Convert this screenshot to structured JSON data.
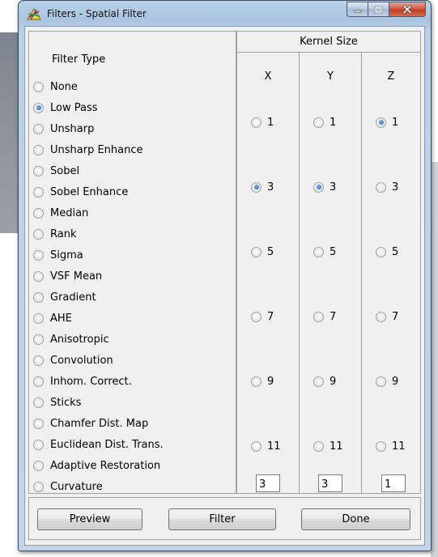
{
  "window": {
    "title": "Filters - Spatial Filter",
    "app_icon": "triangle-axes-icon",
    "controls": [
      "minimize-icon",
      "maximize-icon",
      "close-icon"
    ]
  },
  "filter_type": {
    "heading": "Filter Type",
    "selected": "Low Pass",
    "options": [
      "None",
      "Low Pass",
      "Unsharp",
      "Unsharp Enhance",
      "Sobel",
      "Sobel Enhance",
      "Median",
      "Rank",
      "Sigma",
      "VSF Mean",
      "Gradient",
      "AHE",
      "Anisotropic",
      "Convolution",
      "Inhom. Correct.",
      "Sticks",
      "Chamfer Dist. Map",
      "Euclidean Dist. Trans.",
      "Adaptive Restoration",
      "Curvature"
    ]
  },
  "kernel_size": {
    "heading": "Kernel Size",
    "columns": [
      {
        "axis": "X",
        "selected": "3",
        "value": "3"
      },
      {
        "axis": "Y",
        "selected": "3",
        "value": "3"
      },
      {
        "axis": "Z",
        "selected": "1",
        "value": "1"
      }
    ],
    "sizes": [
      "1",
      "3",
      "5",
      "7",
      "9",
      "11"
    ]
  },
  "buttons": {
    "preview": "Preview",
    "filter": "Filter",
    "done": "Done"
  },
  "colors": {
    "title_bar": "#b9d1ea",
    "close_button": "#c0391f",
    "radio_selected": "#1f5bb5",
    "dialog_background": "#f0f0f0"
  }
}
